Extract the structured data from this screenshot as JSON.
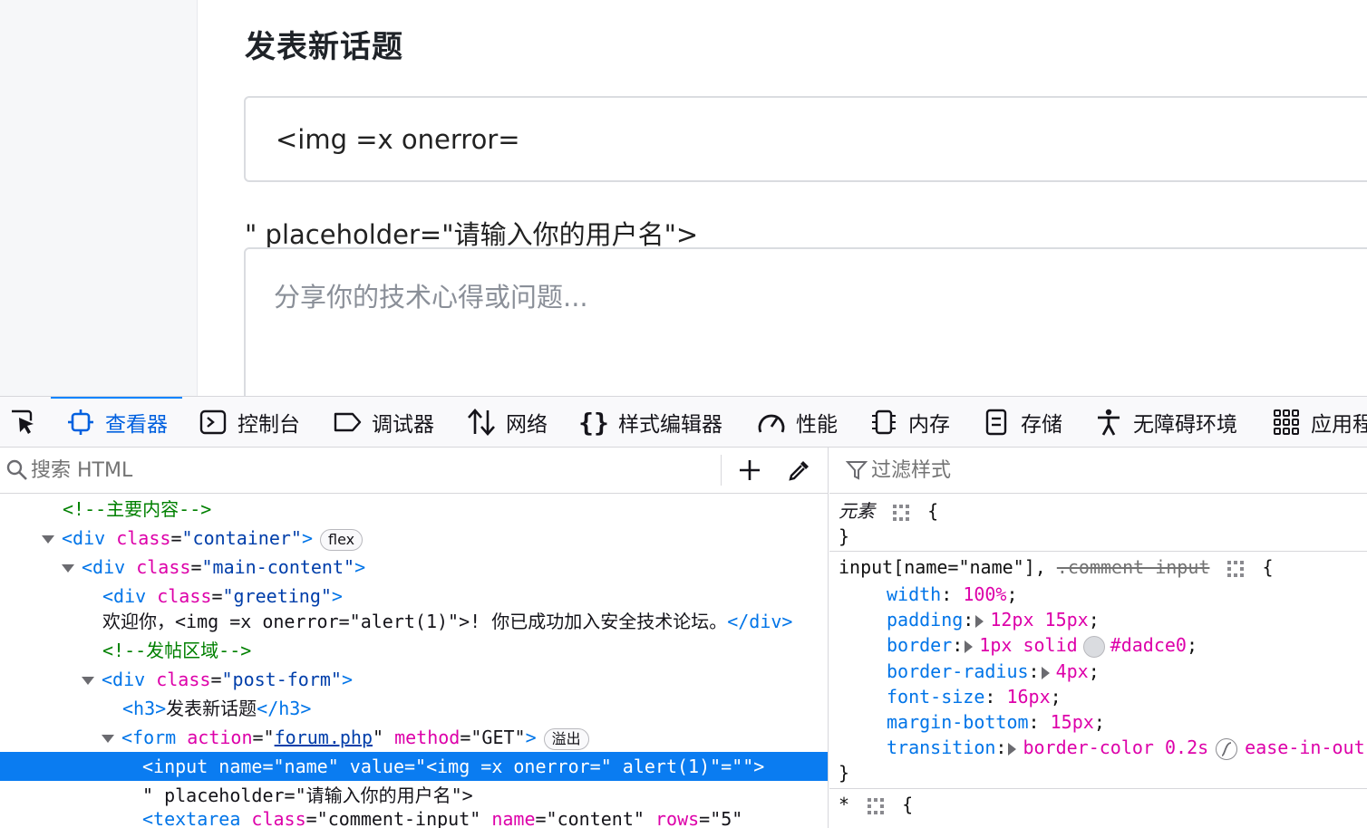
{
  "page": {
    "post_title": "发表新话题",
    "name_input_value": "<img =x onerror=",
    "stray_text": "\" placeholder=\"请输入你的用户名\">",
    "content_placeholder": "分享你的技术心得或问题..."
  },
  "devtools": {
    "tabs": [
      {
        "label": "查看器",
        "icon": "inspector-icon",
        "active": true
      },
      {
        "label": "控制台",
        "icon": "console-icon"
      },
      {
        "label": "调试器",
        "icon": "debugger-icon"
      },
      {
        "label": "网络",
        "icon": "network-icon"
      },
      {
        "label": "样式编辑器",
        "icon": "style-editor-icon"
      },
      {
        "label": "性能",
        "icon": "performance-icon"
      },
      {
        "label": "内存",
        "icon": "memory-icon"
      },
      {
        "label": "存储",
        "icon": "storage-icon"
      },
      {
        "label": "无障碍环境",
        "icon": "accessibility-icon"
      },
      {
        "label": "应用程",
        "icon": "application-icon"
      }
    ],
    "search_placeholder": "搜索 HTML",
    "filter_placeholder": "过滤样式",
    "markup": {
      "comment_main": "<!--主要内容-->",
      "container_tag_open": "<div",
      "container_class_attr": "class",
      "container_class_val": "\"container\"",
      "container_close": ">",
      "badge_flex": "flex",
      "main_tag_open": "<div",
      "main_class_attr": "class",
      "main_class_val": "\"main-content\"",
      "main_close": ">",
      "greeting_tag_open": "<div",
      "greeting_class_attr": "class",
      "greeting_class_val": "\"greeting\"",
      "greeting_close": ">",
      "greeting_text": "欢迎你，<img =x onerror=\"alert(1)\">! 你已成功加入安全技术论坛。",
      "greeting_end_tag": "</div>",
      "comment_post": "<!--发帖区域-->",
      "postform_tag_open": "<div",
      "postform_class_attr": "class",
      "postform_class_val": "\"post-form\"",
      "postform_close": ">",
      "h3_open": "<h3>",
      "h3_text": "发表新话题",
      "h3_close": "</h3>",
      "form_tag_open": "<form",
      "form_action_attr": "action",
      "form_eq": "=\"",
      "form_action_val": "forum.php",
      "form_quote": "\"",
      "form_method_attr": "method",
      "form_method_val": "=\"GET\"",
      "form_close": ">",
      "badge_overflow": "溢出",
      "input_line": "<input name=\"name\" value=\"<img =x onerror=\" alert(1)\"=\"\">",
      "placeholder_line": "\" placeholder=\"请输入你的用户名\">",
      "textarea_tag_open": "<textarea",
      "textarea_class_attr": "class",
      "textarea_class_val": "=\"comment-input\"",
      "textarea_name_attr": "name",
      "textarea_name_val": "=\"content\"",
      "textarea_rows_attr": "rows",
      "textarea_rows_val": "=\"5\""
    },
    "rules": {
      "element_selector": "元素",
      "open_brace": "{",
      "close_brace": "}",
      "input_selector": "input[name=\"name\"],",
      "struck_selector": ".comment-input",
      "decls": {
        "width_name": "width",
        "width_value": "100%",
        "padding_name": "padding",
        "padding_value": "12px 15px",
        "border_name": "border",
        "border_value_a": "1px solid",
        "border_value_b": "#dadce0",
        "radius_name": "border-radius",
        "radius_value": "4px",
        "fontsize_name": "font-size",
        "fontsize_value": "16px",
        "mb_name": "margin-bottom",
        "mb_value": "15px",
        "transition_name": "transition",
        "transition_value_a": "border-color 0.2s",
        "transition_value_b": "ease-in-out"
      },
      "universal_selector": "*"
    }
  },
  "colors": {
    "accent": "#0a84ff",
    "selection": "#0a7cf1",
    "swatch": "#dadce0"
  }
}
